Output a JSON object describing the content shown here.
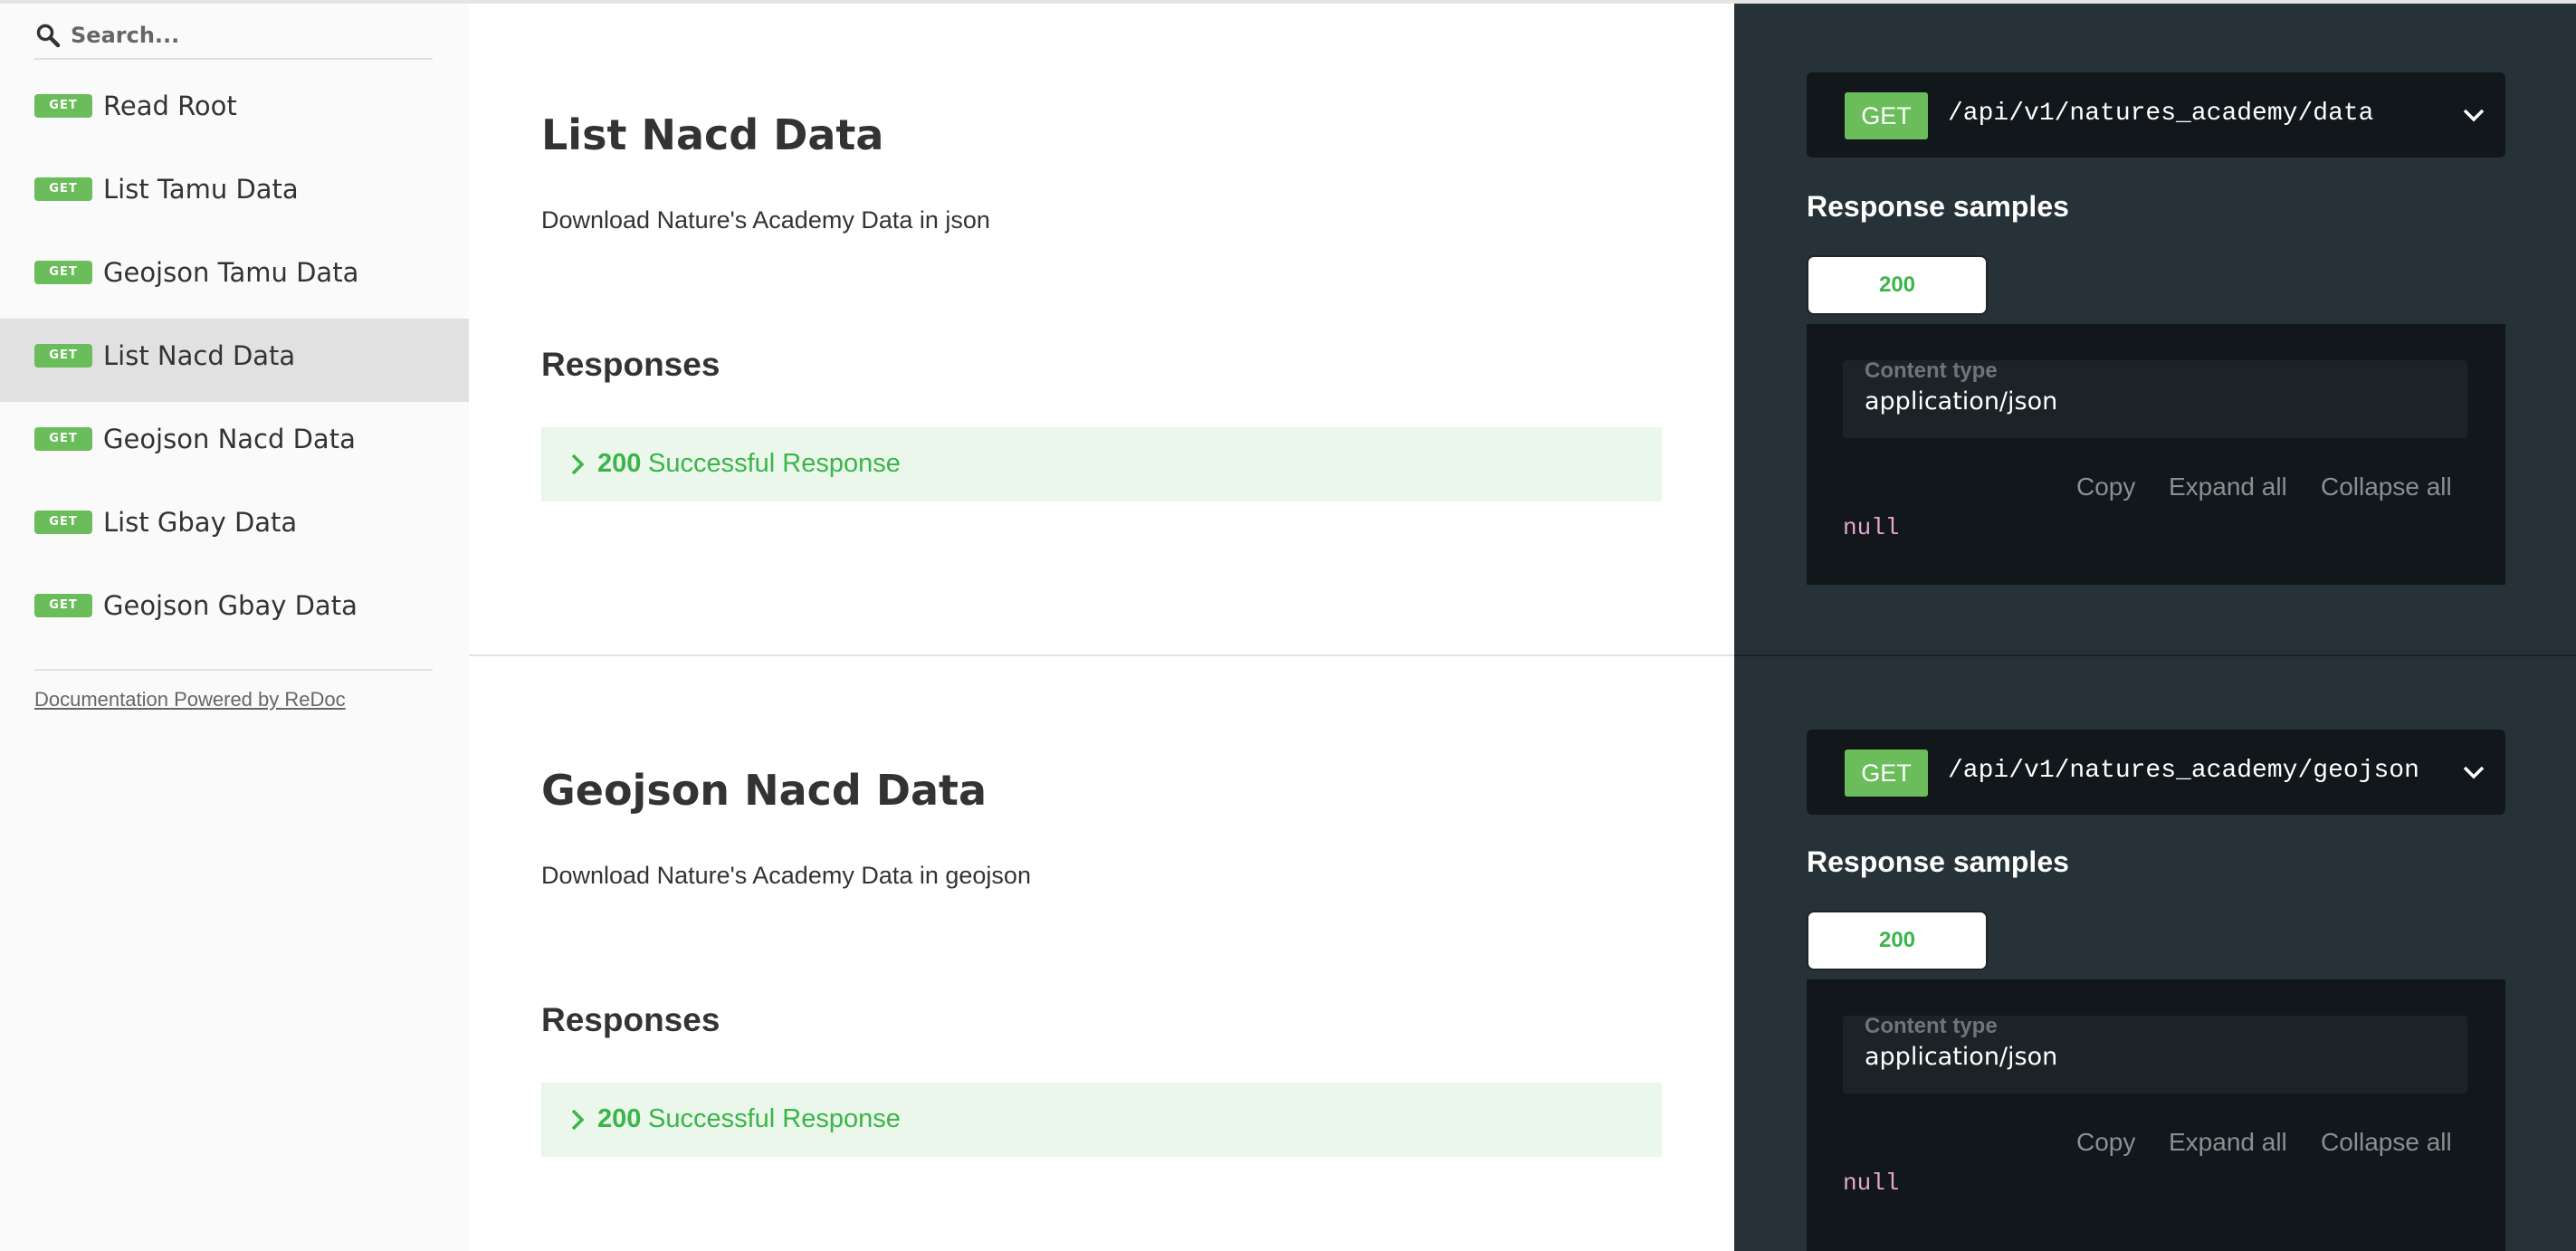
{
  "search": {
    "placeholder": "Search..."
  },
  "sidebar": {
    "items": [
      {
        "method": "GET",
        "label": "Read Root"
      },
      {
        "method": "GET",
        "label": "List Tamu Data"
      },
      {
        "method": "GET",
        "label": "Geojson Tamu Data"
      },
      {
        "method": "GET",
        "label": "List Nacd Data",
        "active": true
      },
      {
        "method": "GET",
        "label": "Geojson Nacd Data"
      },
      {
        "method": "GET",
        "label": "List Gbay Data"
      },
      {
        "method": "GET",
        "label": "Geojson Gbay Data"
      }
    ],
    "powered_by": "Documentation Powered by ReDoc"
  },
  "sections": [
    {
      "title": "List Nacd Data",
      "description": "Download Nature's Academy Data in json",
      "responses_heading": "Responses",
      "response": {
        "code": "200",
        "text": "Successful Response"
      },
      "endpoint": {
        "method": "GET",
        "path": "/api/v1/natures_academy/data"
      },
      "samples_heading": "Response samples",
      "tab": "200",
      "content_type_label": "Content type",
      "content_type_value": "application/json",
      "copy_label": "Copy",
      "expand_label": "Expand all",
      "collapse_label": "Collapse all",
      "sample_body": "null"
    },
    {
      "title": "Geojson Nacd Data",
      "description": "Download Nature's Academy Data in geojson",
      "responses_heading": "Responses",
      "response": {
        "code": "200",
        "text": "Successful Response"
      },
      "endpoint": {
        "method": "GET",
        "path": "/api/v1/natures_academy/geojson"
      },
      "samples_heading": "Response samples",
      "tab": "200",
      "content_type_label": "Content type",
      "content_type_value": "application/json",
      "copy_label": "Copy",
      "expand_label": "Expand all",
      "collapse_label": "Collapse all",
      "sample_body": "null"
    }
  ],
  "colors": {
    "method_get": "#6bbd5b",
    "success_green": "#3ab54a",
    "response_bg": "#ebf7ea",
    "dark_panel": "#263238",
    "code_bg": "#11171a",
    "null_token": "#e7a6cf"
  },
  "icons": {
    "search": "search-icon",
    "response_toggle": "chevron-right-icon",
    "endpoint_toggle": "chevron-down-icon"
  }
}
